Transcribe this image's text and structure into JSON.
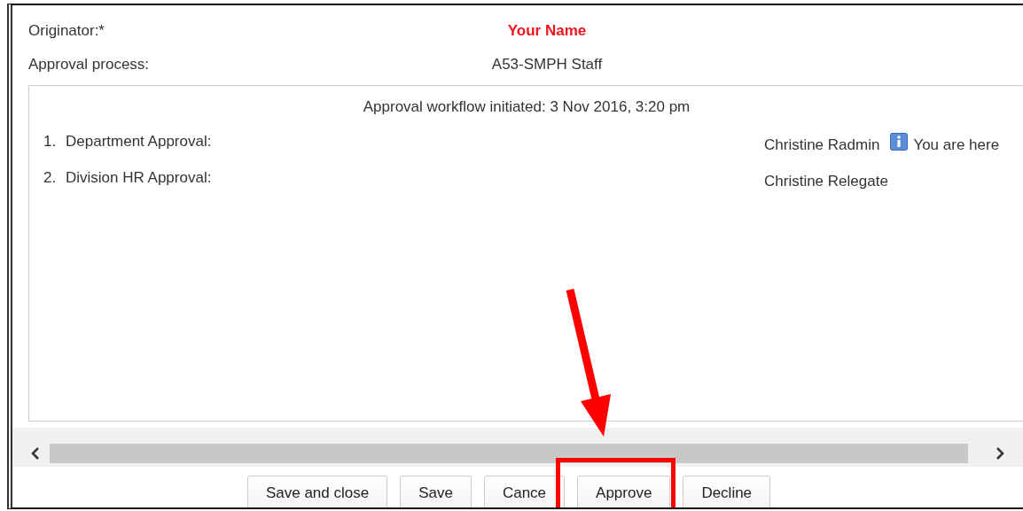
{
  "fields": [
    {
      "label": "Originator:*",
      "value": "Your Name",
      "kind": "highlighted"
    },
    {
      "label": "Approval process:",
      "value": "A53-SMPH Staff",
      "kind": "plain"
    }
  ],
  "workflow": {
    "heading": "Approval workflow initiated: 3 Nov 2016, 3:20 pm",
    "steps": [
      {
        "number": "1.",
        "name": "Department Approval:",
        "approver": "Christine Radmin",
        "current": true,
        "note": "You are here"
      },
      {
        "number": "2.",
        "name": "Division HR Approval:",
        "approver": "Christine Relegate",
        "current": false
      }
    ]
  },
  "buttons": [
    {
      "label": "Save and close",
      "highlighted": false
    },
    {
      "label": "Save",
      "highlighted": false
    },
    {
      "label": "Cance",
      "highlighted": false
    },
    {
      "label": "Approve",
      "highlighted": true
    },
    {
      "label": "Decline",
      "highlighted": false
    }
  ]
}
